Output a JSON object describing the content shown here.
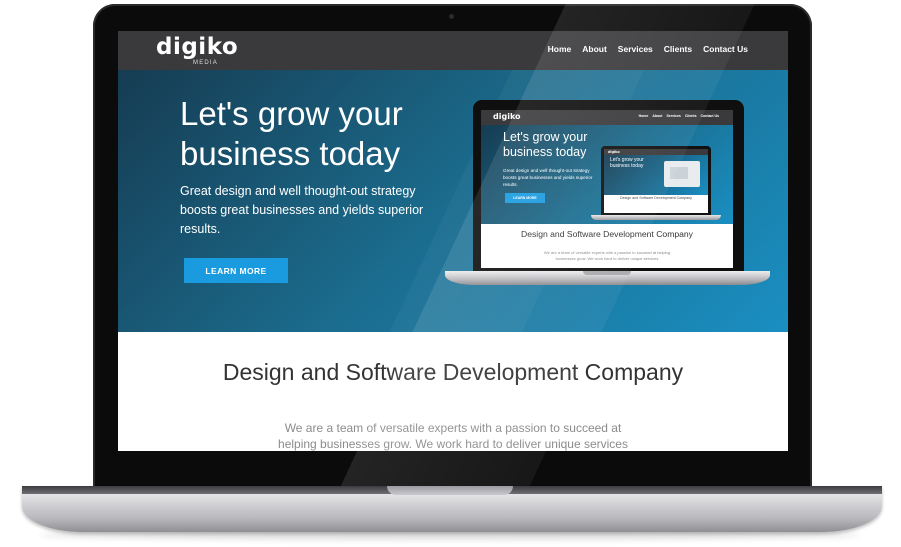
{
  "site": {
    "logo": "digiko",
    "logo_sub": "MEDIA",
    "nav": [
      "Home",
      "About",
      "Services",
      "Clients",
      "Contact Us"
    ],
    "hero_title": "Let's grow your business today",
    "hero_text": "Great design and well thought-out strategy boosts great businesses and yields superior results.",
    "cta": "LEARN MORE",
    "section_title": "Design and Software Development Company",
    "section_text": "We are a team of versatile experts with a passion to succeed at helping businesses grow. We work hard to deliver unique services"
  },
  "mock": {
    "logo": "digiko",
    "nav": [
      "Home",
      "About",
      "Services",
      "Clients",
      "Contact Us"
    ],
    "hero_title": "Let's grow your business today",
    "hero_text": "Great design and well thought-out strategy boosts great businesses and yields superior results.",
    "cta": "LEARN MORE",
    "section_title": "Design and Software Development Company",
    "section_text": "We are a team of versatile experts with a passion to succeed at helping businesses grow. We work hard to deliver unique services"
  },
  "mini": {
    "logo": "digiko",
    "hero_title": "Let's grow your business today",
    "section_title": "Design and Software Development Company"
  },
  "colors": {
    "nav_bg": "#3a3a3c",
    "accent": "#1a9be0",
    "hero_start": "#163c52",
    "hero_end": "#1a8fc2"
  }
}
